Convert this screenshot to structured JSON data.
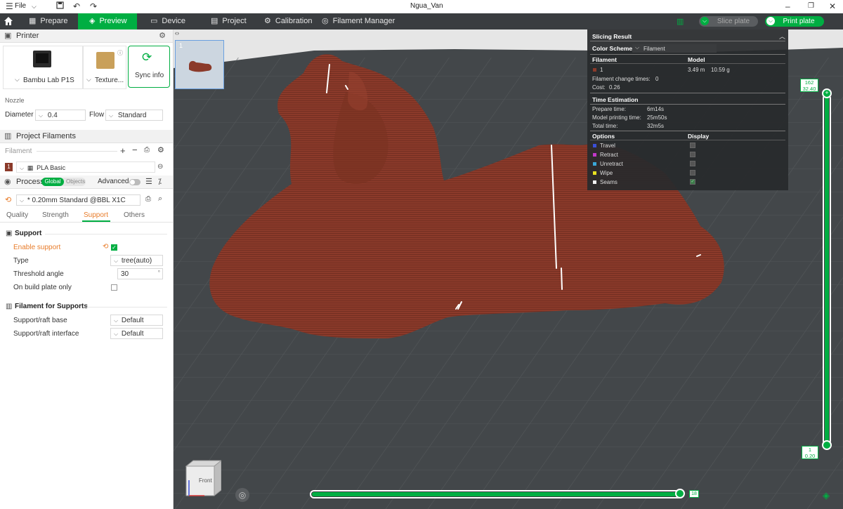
{
  "titlebar": {
    "file_label": "File",
    "title": "Ngua_Van"
  },
  "menubar": {
    "tabs": [
      {
        "label": "Prepare",
        "icon": "prepare-icon"
      },
      {
        "label": "Preview",
        "icon": "preview-icon"
      },
      {
        "label": "Device",
        "icon": "device-icon"
      },
      {
        "label": "Project",
        "icon": "project-icon"
      },
      {
        "label": "Calibration",
        "icon": "calibration-icon"
      },
      {
        "label": "Filament Manager",
        "icon": "filament-manager-icon"
      }
    ],
    "slice_label": "Slice plate",
    "print_label": "Print plate",
    "accent": "#00ae42"
  },
  "printer": {
    "header": "Printer",
    "printer_name": "Bambu Lab P1S",
    "plate_name": "Texture...",
    "sync_label": "Sync info",
    "nozzle_label": "Nozzle",
    "diameter_label": "Diameter",
    "diameter_value": "0.4",
    "flow_label": "Flow",
    "flow_value": "Standard"
  },
  "filaments": {
    "header": "Project Filaments",
    "filament_label": "Filament",
    "items": [
      {
        "index": "1",
        "name": "PLA Basic",
        "color": "#8b3a2a"
      }
    ]
  },
  "process": {
    "header": "Process",
    "global_label": "Global",
    "objects_label": "Objects",
    "advanced_label": "Advanced",
    "preset": "* 0.20mm Standard @BBL X1C",
    "tabs": [
      "Quality",
      "Strength",
      "Support",
      "Others"
    ],
    "active_tab": "Support"
  },
  "support": {
    "section_title": "Support",
    "enable_label": "Enable support",
    "type_label": "Type",
    "type_value": "tree(auto)",
    "threshold_label": "Threshold angle",
    "threshold_value": "30",
    "threshold_unit": "°",
    "build_plate_label": "On build plate only",
    "filament_section_title": "Filament for Supports",
    "base_label": "Support/raft base",
    "base_value": "Default",
    "interface_label": "Support/raft interface",
    "interface_value": "Default"
  },
  "plate": {
    "number": "1"
  },
  "slicing": {
    "title": "Slicing Result",
    "color_scheme_label": "Color Scheme",
    "color_scheme_value": "Filament",
    "col_filament": "Filament",
    "col_model": "Model",
    "filament_index": "1",
    "model_length": "3.49 m",
    "model_weight": "10.59 g",
    "change_times_label": "Filament change times:",
    "change_times_value": "0",
    "cost_label": "Cost:",
    "cost_value": "0.26",
    "time_title": "Time Estimation",
    "prepare_label": "Prepare time:",
    "prepare_value": "6m14s",
    "model_time_label": "Model printing time:",
    "model_time_value": "25m50s",
    "total_label": "Total time:",
    "total_value": "32m5s",
    "options_label": "Options",
    "display_label": "Display",
    "options": [
      {
        "label": "Travel",
        "color": "#3a4fd8"
      },
      {
        "label": "Retract",
        "color": "#c238c9"
      },
      {
        "label": "Unretract",
        "color": "#3aa8d8"
      },
      {
        "label": "Wipe",
        "color": "#e8e020"
      },
      {
        "label": "Seams",
        "color": "#f2f2f2"
      }
    ]
  },
  "layer_slider": {
    "top_layer": "162",
    "top_height": "32.40",
    "bottom_layer": "1",
    "bottom_height": "0.20"
  },
  "move_slider": {
    "value": "18",
    "fraction": 0.99
  },
  "view_cube": {
    "face_label": "Front"
  }
}
